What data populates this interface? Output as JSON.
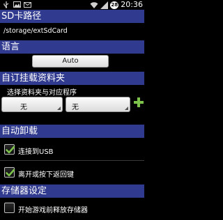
{
  "status_bar": {
    "battery": "28",
    "time": "20:36"
  },
  "sections": {
    "sd_path": {
      "title": "SD卡路径",
      "path": "/storage/extSdCard"
    },
    "language": {
      "title": "语言",
      "value": "Auto"
    },
    "custom_mount": {
      "title": "自订挂载资料夹",
      "subtitle": "选择资料夹与对应程序",
      "folder_select": "无",
      "app_select": "无"
    },
    "auto_unmount": {
      "title": "自动卸载",
      "usb_label": "连接到USB",
      "usb_checked": true,
      "exit_label": "离开或按下返回键",
      "exit_checked": true
    },
    "storage": {
      "title": "存储器设定",
      "release_label": "开始游戏前释放存储器",
      "release_checked": false
    }
  },
  "colors": {
    "header_bg": "#303a8e",
    "accent_green": "#7dc24b"
  }
}
